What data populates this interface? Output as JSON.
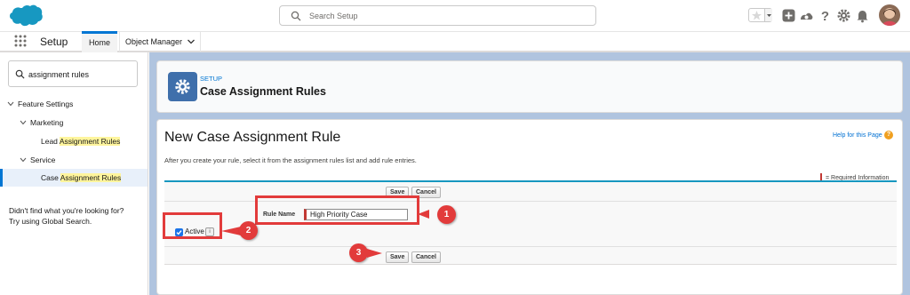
{
  "header": {
    "search_placeholder": "Search Setup",
    "icons": [
      "favorites-star-icon",
      "add-icon",
      "trailhead-icon",
      "help-icon",
      "gear-icon",
      "bell-icon",
      "avatar"
    ]
  },
  "nav": {
    "app_name": "Setup",
    "tabs": [
      {
        "label": "Home",
        "active": true
      },
      {
        "label": "Object Manager",
        "active": false
      }
    ]
  },
  "sidebar": {
    "quick_find_value": "assignment rules",
    "tree": {
      "feature_settings": "Feature Settings",
      "marketing": "Marketing",
      "lead_prefix": "Lead ",
      "lead_hl": "Assignment Rules",
      "service": "Service",
      "case_prefix": "Case ",
      "case_hl": "Assignment Rules"
    },
    "not_found_line1": "Didn't find what you're looking for?",
    "not_found_line2": "Try using Global Search."
  },
  "page_header": {
    "eyebrow": "SETUP",
    "title": "Case Assignment Rules"
  },
  "content": {
    "heading": "New Case Assignment Rule",
    "help_link": "Help for this Page",
    "intro": "After you create your rule, select it from the assignment rules list and add rule entries.",
    "required_info": "= Required Information",
    "save_label": "Save",
    "cancel_label": "Cancel",
    "rule_name_label": "Rule Name",
    "rule_name_value": "High Priority Case",
    "active_label": "Active",
    "active_info": "i",
    "active_checked": true
  },
  "annotations": {
    "step1": "1",
    "step2": "2",
    "step3": "3",
    "color": "#e23b3b"
  },
  "colors": {
    "brand_blue": "#0176d3",
    "setup_icon": "#3f6fab",
    "page_bg": "#b0c4df",
    "highlight": "#fff59d"
  }
}
